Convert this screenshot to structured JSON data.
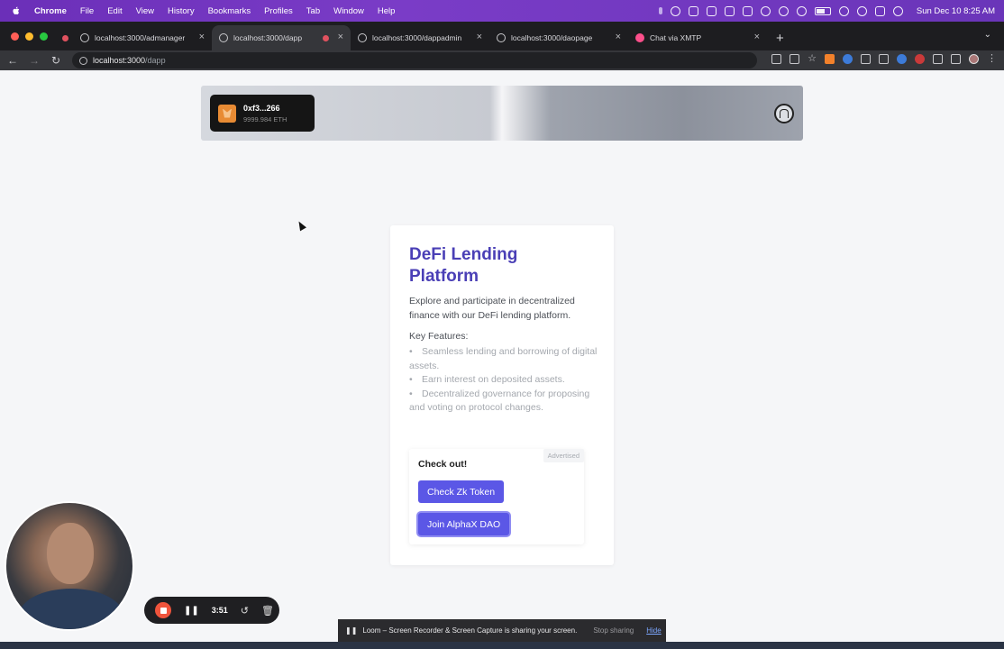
{
  "menubar": {
    "app": "Chrome",
    "items": [
      "File",
      "Edit",
      "View",
      "History",
      "Bookmarks",
      "Profiles",
      "Tab",
      "Window",
      "Help"
    ],
    "datetime": "Sun Dec 10  8:25 AM"
  },
  "tabs": [
    {
      "title": "localhost:3000/admanager",
      "active": false
    },
    {
      "title": "localhost:3000/dapp",
      "active": true
    },
    {
      "title": "localhost:3000/dappadmin",
      "active": false
    },
    {
      "title": "localhost:3000/daopage",
      "active": false
    },
    {
      "title": "Chat via XMTP",
      "active": false
    }
  ],
  "address_bar": {
    "host": "localhost:3000",
    "path": "/dapp"
  },
  "wallet": {
    "address": "0xf3...266",
    "balance": "9999.984 ETH"
  },
  "card": {
    "title": "DeFi Lending Platform",
    "intro": "Explore and participate in decentralized finance with our DeFi lending platform.",
    "features_heading": "Key Features:",
    "features": [
      "Seamless lending and borrowing of digital assets.",
      "Earn interest on deposited assets.",
      "Decentralized governance for proposing and voting on protocol changes."
    ],
    "ad": {
      "tag": "Advertised",
      "title": "Check out!",
      "button1": "Check Zk Token",
      "button2": "Join AlphaX DAO"
    }
  },
  "loom": {
    "timer": "3:51",
    "share_message": "Loom – Screen Recorder & Screen Capture is sharing your screen.",
    "stop_label": "Stop sharing",
    "hide_label": "Hide"
  },
  "colors": {
    "accent": "#5b57e6",
    "title": "#4a3fb6",
    "menubar": "#6b2fb8"
  }
}
